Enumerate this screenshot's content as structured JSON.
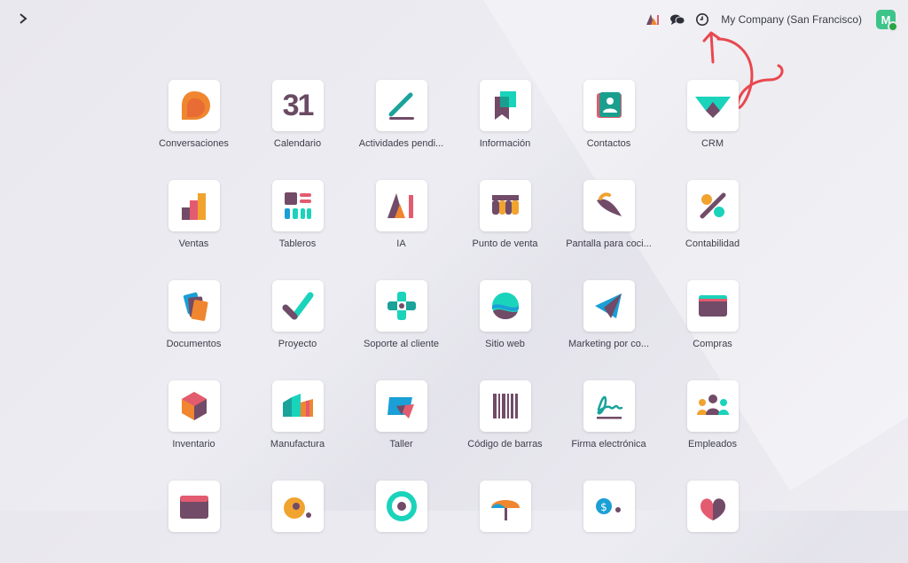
{
  "topbar": {
    "company_name": "My Company (San Francisco)",
    "avatar_initial": "M",
    "icons": [
      "ai-icon",
      "chat-icon",
      "clock-icon"
    ]
  },
  "apps": [
    {
      "label": "Conversaciones",
      "icon": "discuss-icon"
    },
    {
      "label": "Calendario",
      "icon": "calendar-icon",
      "glyph": "31"
    },
    {
      "label": "Actividades pendi...",
      "icon": "todo-icon"
    },
    {
      "label": "Información",
      "icon": "knowledge-icon"
    },
    {
      "label": "Contactos",
      "icon": "contacts-icon"
    },
    {
      "label": "CRM",
      "icon": "crm-icon"
    },
    {
      "label": "Ventas",
      "icon": "sales-icon"
    },
    {
      "label": "Tableros",
      "icon": "dashboards-icon"
    },
    {
      "label": "IA",
      "icon": "ai-app-icon",
      "glyph": "AI"
    },
    {
      "label": "Punto de venta",
      "icon": "pos-icon"
    },
    {
      "label": "Pantalla para coci...",
      "icon": "kitchen-display-icon"
    },
    {
      "label": "Contabilidad",
      "icon": "accounting-icon"
    },
    {
      "label": "Documentos",
      "icon": "documents-icon"
    },
    {
      "label": "Proyecto",
      "icon": "project-icon"
    },
    {
      "label": "Soporte al cliente",
      "icon": "helpdesk-icon"
    },
    {
      "label": "Sitio web",
      "icon": "website-icon"
    },
    {
      "label": "Marketing por co...",
      "icon": "email-marketing-icon"
    },
    {
      "label": "Compras",
      "icon": "purchase-icon"
    },
    {
      "label": "Inventario",
      "icon": "inventory-icon"
    },
    {
      "label": "Manufactura",
      "icon": "manufacturing-icon"
    },
    {
      "label": "Taller",
      "icon": "repair-icon"
    },
    {
      "label": "Código de barras",
      "icon": "barcode-icon"
    },
    {
      "label": "Firma electrónica",
      "icon": "sign-icon"
    },
    {
      "label": "Empleados",
      "icon": "employees-icon"
    },
    {
      "label": "",
      "icon": "app-icon-r5c1"
    },
    {
      "label": "",
      "icon": "app-icon-r5c2"
    },
    {
      "label": "",
      "icon": "app-icon-r5c3"
    },
    {
      "label": "",
      "icon": "app-icon-r5c4"
    },
    {
      "label": "",
      "icon": "app-icon-r5c5"
    },
    {
      "label": "",
      "icon": "app-icon-r5c6"
    }
  ],
  "colors": {
    "purple": "#714b67",
    "teal": "#1ad3bb",
    "orange": "#f0862f",
    "pink": "#e35b6f",
    "annotation_red": "#e8484f"
  }
}
